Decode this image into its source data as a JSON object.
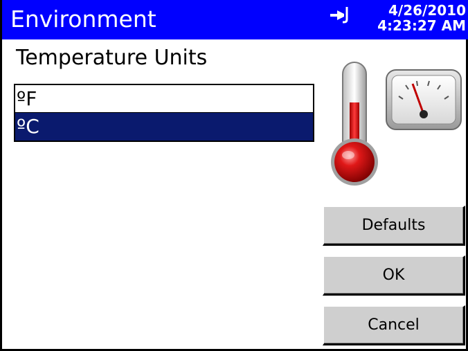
{
  "window": {
    "title": "Environment",
    "date": "4/26/2010",
    "time": "4:23:27 AM",
    "status_icon": "power-plug-icon"
  },
  "temperature": {
    "label": "Temperature Units",
    "options": [
      "ºF",
      "ºC"
    ],
    "selected": "ºC"
  },
  "illustration": {
    "icons": [
      "thermometer-icon",
      "gauge-icon"
    ]
  },
  "buttons": {
    "defaults": "Defaults",
    "ok": "OK",
    "cancel": "Cancel"
  },
  "colors": {
    "titlebar": "#0000ff",
    "selection": "#0a1a6e",
    "button_face": "#cfcfcf"
  }
}
